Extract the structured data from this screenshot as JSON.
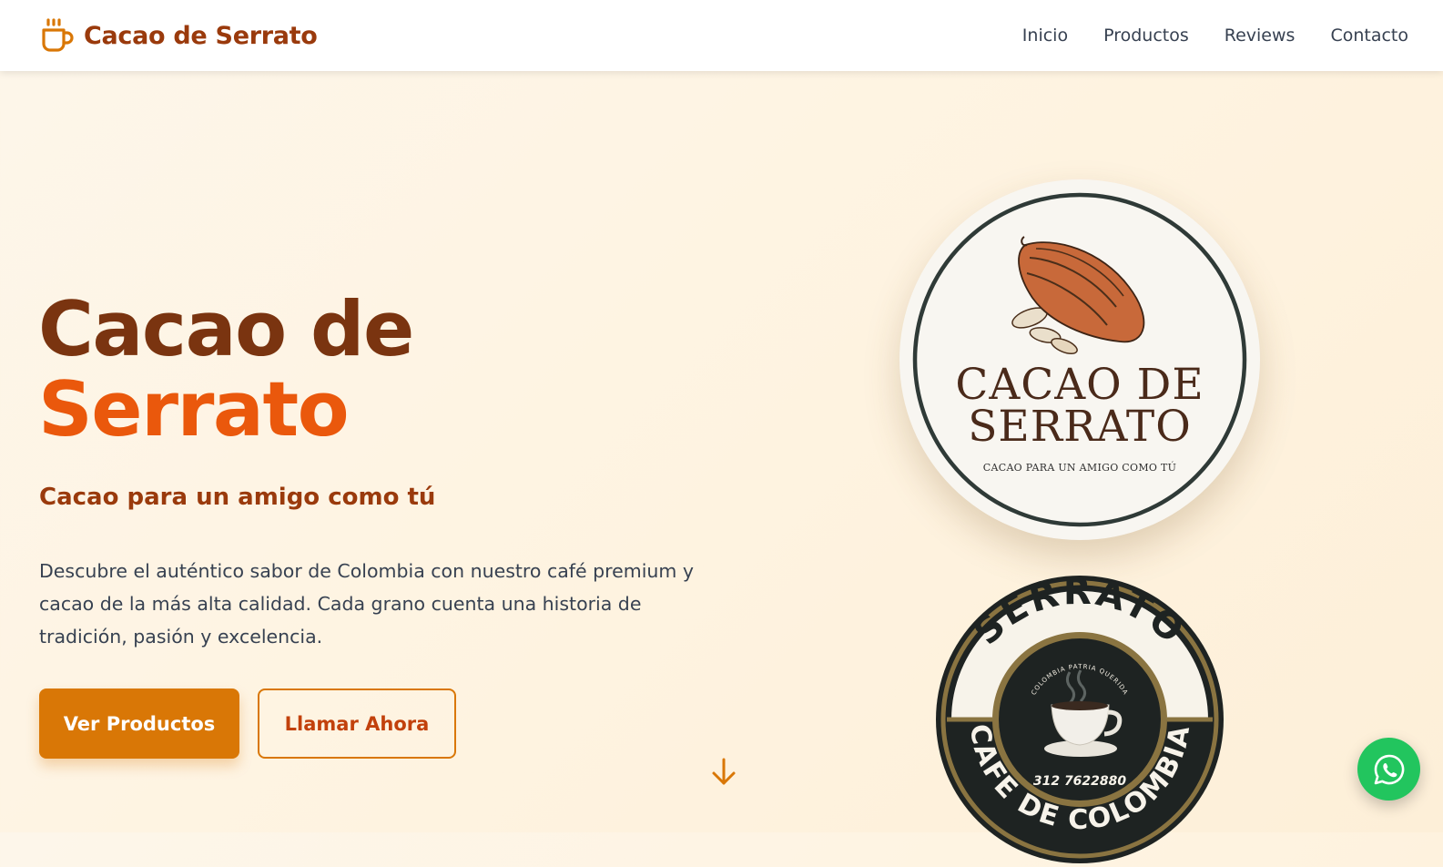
{
  "nav": {
    "brand": "Cacao de Serrato",
    "links": [
      "Inicio",
      "Productos",
      "Reviews",
      "Contacto"
    ]
  },
  "hero": {
    "title_line1": "Cacao de",
    "title_line2": "Serrato",
    "subtitle": "Cacao para un amigo como tú",
    "description": "Descubre el auténtico sabor de Colombia con nuestro café premium y cacao de la más alta calidad. Cada grano cuenta una historia de tradición, pasión y excelencia.",
    "primary_button": "Ver Productos",
    "secondary_button": "Llamar Ahora"
  },
  "logo_cacao": {
    "name_line1": "CACAO DE",
    "name_line2": "SERRATO",
    "tagline": "CACAO PARA UN AMIGO COMO TÚ"
  },
  "logo_cafe": {
    "top_text": "SERRATO",
    "inner_text": "COLOMBIA PATRIA QUERIDA",
    "phone": "312 7622880",
    "bottom_text": "CAFE DE COLOMBIA"
  },
  "icons": {
    "brand": "coffee-cup-icon",
    "scroll": "arrow-down-icon",
    "whatsapp": "whatsapp-icon"
  },
  "colors": {
    "brand_brown": "#9a3a0c",
    "title_brown": "#7a3410",
    "accent_orange": "#ea580c",
    "button_amber": "#d97706",
    "whatsapp_green": "#22c55e"
  }
}
